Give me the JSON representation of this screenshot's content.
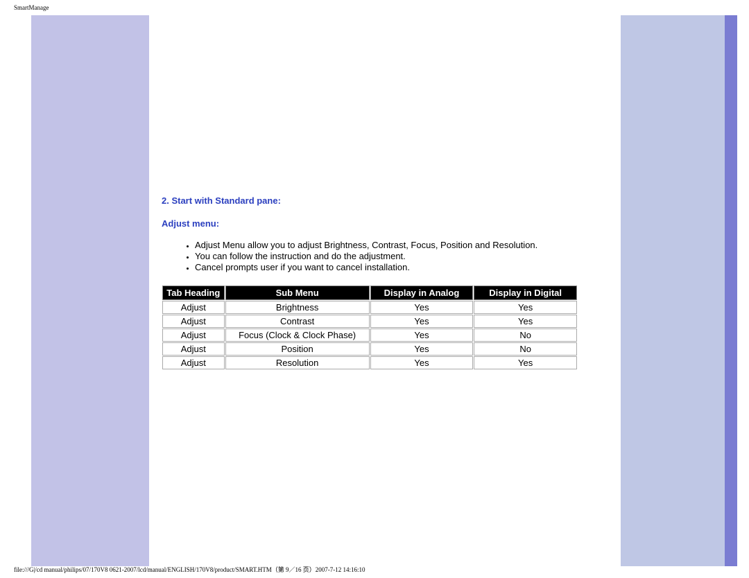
{
  "page": {
    "header_title": "SmartManage",
    "footer_path": "file:///G|/cd manual/philips/07/170V8 0621-2007/lcd/manual/ENGLISH/170V8/product/SMART.HTM（第 9／16 页）2007-7-12 14:16:10"
  },
  "section": {
    "heading": "2. Start with Standard pane:",
    "sub_heading": "Adjust menu:",
    "bullets": {
      "b1": "Adjust Menu allow you to adjust Brightness, Contrast, Focus, Position and Resolution.",
      "b2": "You can follow the instruction and do the adjustment.",
      "b3": "Cancel prompts user if you want to cancel installation."
    }
  },
  "table": {
    "headers": {
      "h1": "Tab Heading",
      "h2": "Sub Menu",
      "h3": "Display in Analog",
      "h4": "Display in Digital"
    },
    "rows": {
      "r1": {
        "c1": "Adjust",
        "c2": "Brightness",
        "c3": "Yes",
        "c4": "Yes"
      },
      "r2": {
        "c1": "Adjust",
        "c2": "Contrast",
        "c3": "Yes",
        "c4": "Yes"
      },
      "r3": {
        "c1": "Adjust",
        "c2": "Focus (Clock & Clock Phase)",
        "c3": "Yes",
        "c4": "No"
      },
      "r4": {
        "c1": "Adjust",
        "c2": "Position",
        "c3": "Yes",
        "c4": "No"
      },
      "r5": {
        "c1": "Adjust",
        "c2": "Resolution",
        "c3": "Yes",
        "c4": "Yes"
      }
    }
  }
}
